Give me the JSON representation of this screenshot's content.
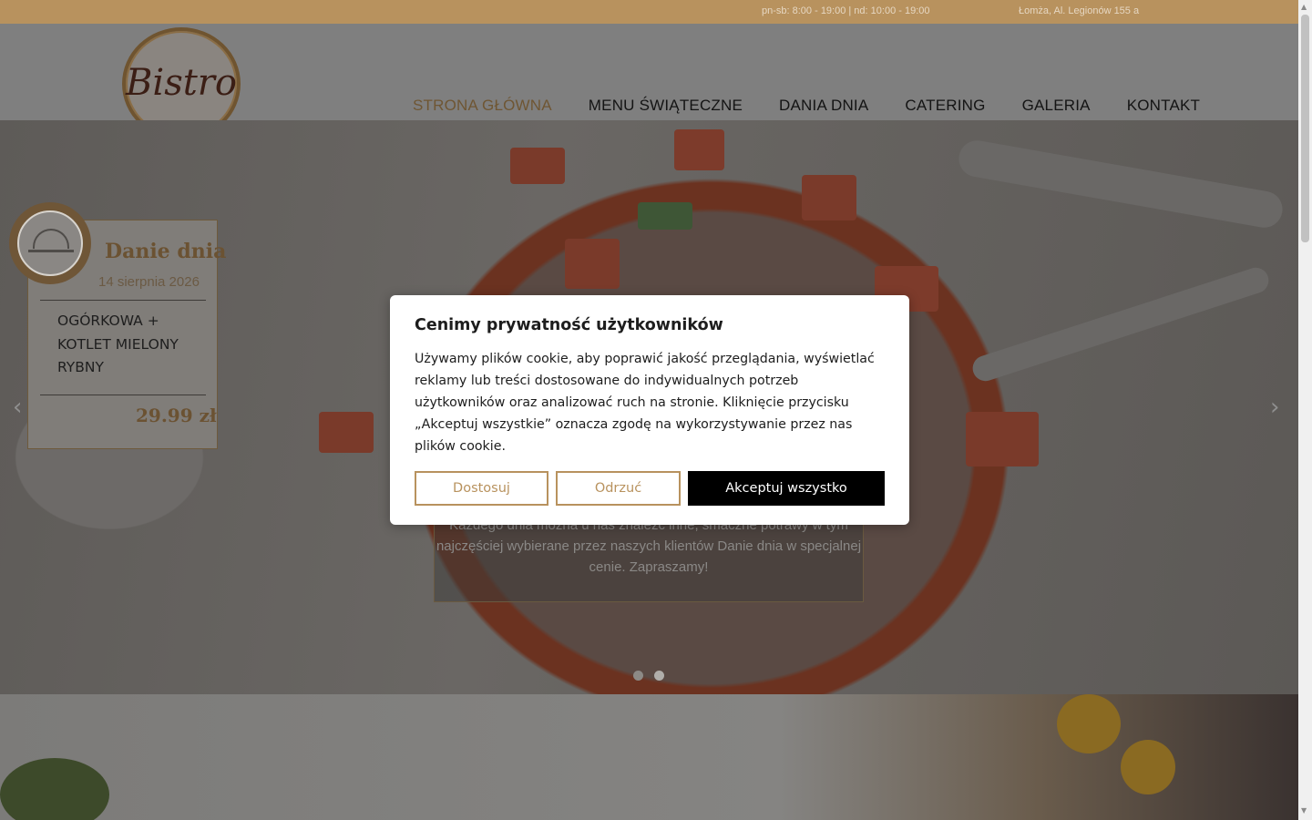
{
  "topbar": {
    "hours": "pn-sb: 8:00 - 19:00 | nd: 10:00 - 19:00",
    "address": "Łomża, Al. Legionów 155 a"
  },
  "header": {
    "logo_text": "Bistro",
    "nav": [
      {
        "label": "STRONA GŁÓWNA",
        "active": true
      },
      {
        "label": "MENU ŚWIĄTECZNE",
        "active": false
      },
      {
        "label": "DANIA DNIA",
        "active": false
      },
      {
        "label": "CATERING",
        "active": false
      },
      {
        "label": "GALERIA",
        "active": false
      },
      {
        "label": "KONTAKT",
        "active": false
      }
    ]
  },
  "hero": {
    "prev_arrow": "‹",
    "next_arrow": "›",
    "caption": "Każdego dnia można u nas znaleźć inne, smaczne potrawy w tym najczęściej wybierane przez naszych klientów Danie dnia w specjalnej cenie. Zapraszamy!",
    "slides_count": 2,
    "active_slide": 2
  },
  "dish_card": {
    "title": "Danie dnia",
    "date": "14 sierpnia 2026",
    "name": "OGÓRKOWA + KOTLET MIELONY RYBNY",
    "price": "29.99 zł",
    "icon": "cloche-icon"
  },
  "cookie_modal": {
    "title": "Cenimy prywatność użytkowników",
    "body": "Używamy plików cookie, aby poprawić jakość przeglądania, wyświetlać reklamy lub treści dostosowane do indywidualnych potrzeb użytkowników oraz analizować ruch na stronie. Kliknięcie przycisku „Akceptuj wszystkie” oznacza zgodę na wykorzystywanie przez nas plików cookie.",
    "customize_label": "Dostosuj",
    "reject_label": "Odrzuć",
    "accept_label": "Akceptuj wszystko"
  },
  "colors": {
    "accent": "#b8925e",
    "accept_bg": "#000000",
    "modal_bg": "#ffffff"
  }
}
